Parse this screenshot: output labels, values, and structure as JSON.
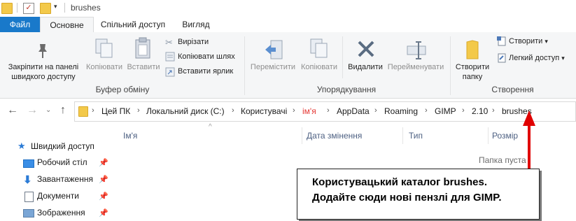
{
  "titlebar": {
    "title": "brushes"
  },
  "tabs": [
    {
      "label": "Файл"
    },
    {
      "label": "Основне"
    },
    {
      "label": "Спільний доступ"
    },
    {
      "label": "Вигляд"
    }
  ],
  "ribbon": {
    "clipboard": {
      "pin_label_1": "Закріпити на панелі",
      "pin_label_2": "швидкого доступу",
      "copy_label": "Копіювати",
      "paste_label": "Вставити",
      "cut_label": "Вирізати",
      "copy_path_label": "Копіювати шлях",
      "paste_shortcut_label": "Вставити ярлик",
      "group_label": "Буфер обміну"
    },
    "organize": {
      "move_label": "Перемістити",
      "copy_label": "Копіювати",
      "delete_label": "Видалити",
      "rename_label": "Перейменувати",
      "group_label": "Упорядкування"
    },
    "create": {
      "new_folder_label_1": "Створити",
      "new_folder_label_2": "папку",
      "new_item_label": "Створити",
      "easy_access_label": "Легкий доступ",
      "group_label": "Створення"
    }
  },
  "address": {
    "crumbs": [
      "Цей ПК",
      "Локальний диск (C:)",
      "Користувачі",
      "ім'я",
      "AppData",
      "Roaming",
      "GIMP",
      "2.10",
      "brushes"
    ],
    "highlight_color": "#e53935"
  },
  "columns": {
    "name": "Ім'я",
    "date": "Дата змінення",
    "type": "Тип",
    "size": "Розмір"
  },
  "content": {
    "empty_text": "Папка пуста"
  },
  "sidebar": {
    "items": [
      {
        "label": "Швидкий доступ",
        "icon": "star-icon"
      },
      {
        "label": "Робочий стіл",
        "icon": "desktop-icon"
      },
      {
        "label": "Завантаження",
        "icon": "download-icon"
      },
      {
        "label": "Документи",
        "icon": "documents-icon"
      },
      {
        "label": "Зображення",
        "icon": "pictures-icon"
      }
    ]
  },
  "callout": {
    "line1": "Користувацький каталог brushes.",
    "line2": "Додайте сюди нові пензлі для GIMP."
  },
  "colors": {
    "accent": "#1979ca",
    "arrow": "#e00000"
  }
}
